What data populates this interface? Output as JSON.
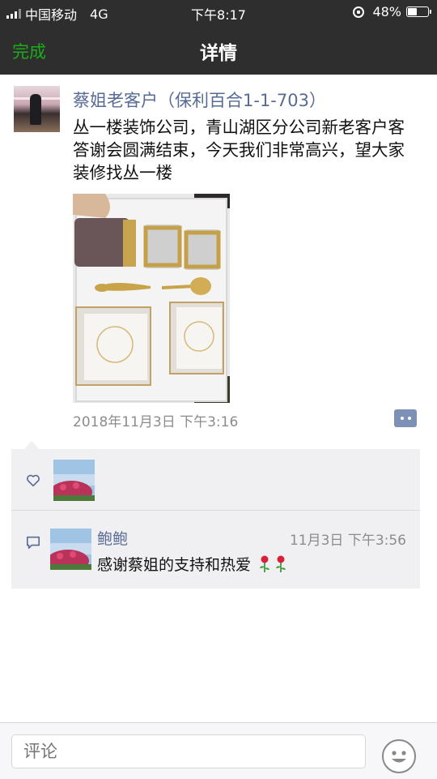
{
  "status_bar": {
    "carrier": "中国移动",
    "network": "4G",
    "time": "下午8:17",
    "battery_percent": "48%",
    "battery_level": 0.48
  },
  "nav": {
    "done_label": "完成",
    "title": "详情"
  },
  "post": {
    "author": "蔡姐老客户（保利百合1-1-703）",
    "text": "丛一楼装饰公司，青山湖区分公司新老客户客答谢会圆满结束，今天我们非常高兴，望大家装修找丛一楼",
    "timestamp": "2018年11月3日 下午3:16"
  },
  "comments": [
    {
      "name": "鲍鲍",
      "time": "11月3日 下午3:56",
      "text": "感谢蔡姐的支持和热爱"
    }
  ],
  "comment_input": {
    "placeholder": "评论"
  },
  "icons": {
    "like": "heart-icon",
    "comment": "comment-icon",
    "emoji": "smiley-icon",
    "rose": "rose-icon",
    "more": "more-actions-icon"
  },
  "colors": {
    "accent_green": "#1aad19",
    "link_blue": "#576b95",
    "nav_bg": "#2e2e2e"
  }
}
